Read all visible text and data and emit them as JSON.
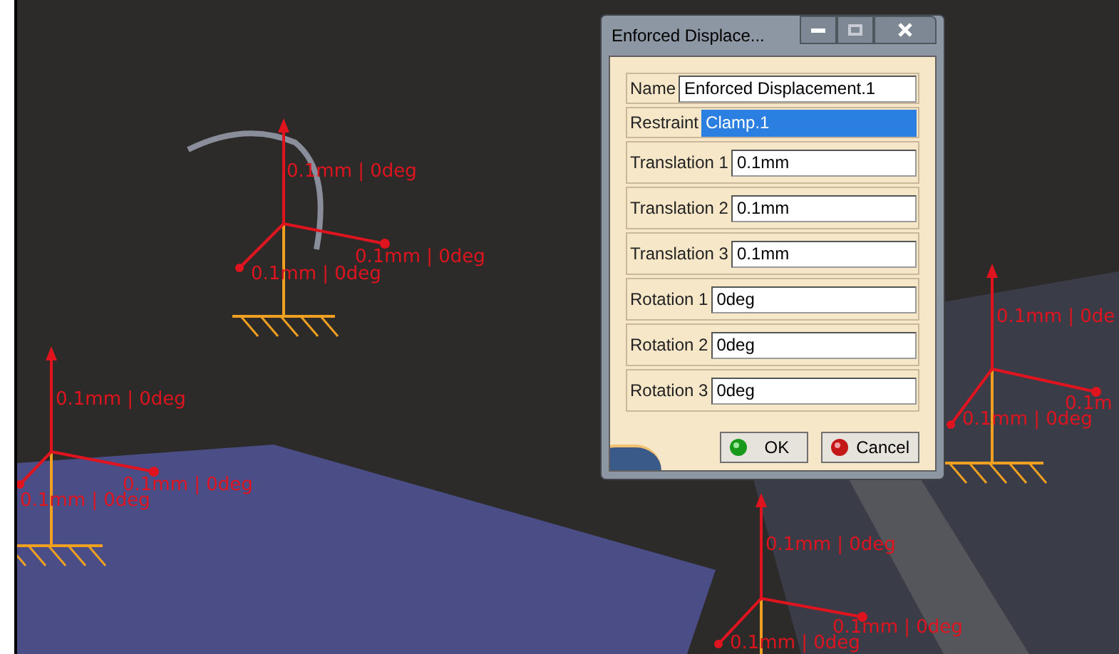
{
  "viewport": {
    "markers": [
      {
        "labels": [
          "0.1mm | 0deg",
          "0.1mm | 0deg",
          "0.1mm | 0deg"
        ]
      },
      {
        "labels": [
          "0.1mm | 0deg",
          "0.1mm | 0deg",
          "0.1mm | 0deg"
        ]
      },
      {
        "labels": [
          "0.1mm | 0de",
          "0.1m",
          "0.1mm | 0deg"
        ]
      },
      {
        "labels": [
          "0.1mm | 0deg",
          "0.1mm | 0deg",
          "0.1mm | 0deg"
        ]
      }
    ]
  },
  "dialog": {
    "title": "Enforced Displace...",
    "fields": [
      {
        "label": "Name",
        "value": "Enforced Displacement.1",
        "highlighted": false
      },
      {
        "label": "Restraint",
        "value": "Clamp.1",
        "highlighted": true
      },
      {
        "label": "Translation 1",
        "value": "0.1mm",
        "highlighted": false
      },
      {
        "label": "Translation 2",
        "value": "0.1mm",
        "highlighted": false
      },
      {
        "label": "Translation 3",
        "value": "0.1mm",
        "highlighted": false
      },
      {
        "label": "Rotation 1",
        "value": "0deg",
        "highlighted": false
      },
      {
        "label": "Rotation 2",
        "value": "0deg",
        "highlighted": false
      },
      {
        "label": "Rotation 3",
        "value": "0deg",
        "highlighted": false
      }
    ],
    "buttons": [
      {
        "label": "OK",
        "kind": "ok"
      },
      {
        "label": "Cancel",
        "kind": "cancel"
      }
    ]
  }
}
